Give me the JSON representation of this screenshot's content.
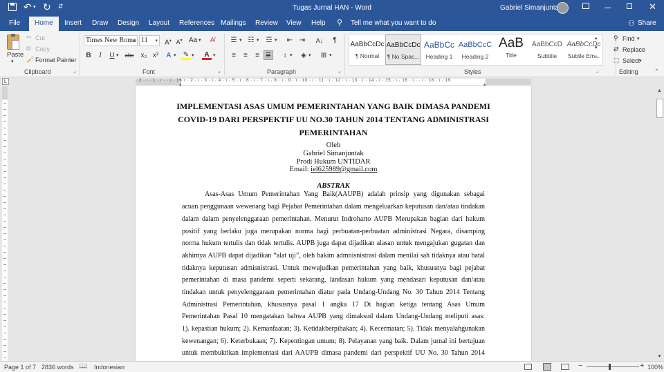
{
  "window": {
    "title": "Tugas Jurnal HAN  -  Word",
    "user": "Gabriel Simanjuntak"
  },
  "tabs": [
    "File",
    "Home",
    "Insert",
    "Draw",
    "Design",
    "Layout",
    "References",
    "Mailings",
    "Review",
    "View",
    "Help"
  ],
  "tell_me": "Tell me what you want to do",
  "share": "Share",
  "clipboard": {
    "paste": "Paste",
    "cut": "Cut",
    "copy": "Copy",
    "format_painter": "Format Painter",
    "label": "Clipboard"
  },
  "font": {
    "name": "Times New Roma",
    "size": "11",
    "label": "Font",
    "bold": "B",
    "italic": "I",
    "underline": "U",
    "strike": "abc",
    "sub": "x₂",
    "sup": "x²",
    "aa": "Aa"
  },
  "paragraph": {
    "label": "Paragraph"
  },
  "styles": {
    "label": "Styles",
    "items": [
      {
        "preview": "AaBbCcDc",
        "name": "¶ Normal"
      },
      {
        "preview": "AaBbCcDc",
        "name": "¶ No Spac..."
      },
      {
        "preview": "AaBbCc",
        "name": "Heading 1"
      },
      {
        "preview": "AaBbCcC",
        "name": "Heading 2"
      },
      {
        "preview": "AaB",
        "name": "Title"
      },
      {
        "preview": "AaBbCcD",
        "name": "Subtitle"
      },
      {
        "preview": "AaBbCcDc",
        "name": "Subtle Em..."
      }
    ]
  },
  "editing": {
    "find": "Find",
    "replace": "Replace",
    "select": "Select",
    "label": "Editing"
  },
  "ruler": "· 2 · ı · 1 · ı ·   · ı · 1 · ı · 2 · ı · 3 · ı · 4 · ı · 5 · ı · 6 · ı · 7 · ı · 8 · ı · 9 · ı · 10 · ı · 11 · ı · 12 · ı · 13 · ı · 14 · ı · 15 · ı · 16 · ı ·   · ı · 18 · ı · 19",
  "document": {
    "title_lines": [
      "IMPLEMENTASI ASAS UMUM PEMERINTAHAN YANG BAIK DIMASA PANDEMI",
      "COVID-19 DARI PERSPEKTIF UU NO.30 TAHUN 2014 TENTANG ADMINISTRASI",
      "PEMERINTAHAN"
    ],
    "oleh": "Oleh",
    "author": "Gabriel Simanjuntak",
    "affiliation": "Prodi Hukum UNTIDAR",
    "email_label": "Email: ",
    "email": "iel625989@gmail.com",
    "abstract_heading": "ABSTRAK",
    "abstract_lines": [
      "Asas-Asas Umum Pemerintahan Yang Baik(AAUPB) adalah prinsip yang digunakan sebagai",
      "acuan penggunaan wewenang bagi Pejabat Pemerintahan dalam mengeluarkan keputusan dan/atau tindakan",
      "dalam dalam penyelenggaraan pemerintahan. Menurut Indroharto AUPB Merupakan bagian dari hukum",
      "positif yang berlaku juga merupakan norma bagi perbuatan-perbuatan administrasi Negara, disamping",
      "norma hukum tertulis dan tidak tertulis. AUPB juga dapat dijadikan alasan untuk mengajukan gugatan dan",
      "akhirnya AUPB dapat dijadikan “alat uji”, oleh hakim admnisnistrasi dalam menilai sah tidaknya atau batal",
      "tidaknya keputusan admisnistrasi. Untuk mewujudkan pemerintahan yang baik, khususnya bagi pejabat",
      "pemerintahan di masa pandemi seperti sekarang, landasan hukum yang mendasari keputusan dan/atau",
      "tindakan untuk penyelenggaraan pemerintahan diatur pada Undang-Undang No. 30 Tahun 2014 Tentang",
      "Administrasi Pemerintahan, khususnya pasal 1 angka 17  Di bagian ketiga tentang Asas Umum",
      "Pemerintahan Pasal 10 mengatakan bahwa AUPB yang dimaksud dalam Undang-Undang meliputi asas:",
      "1). kepastian hukum; 2). Kemanfaatan; 3). Ketidakberpihakan; 4). Kecermatan; 5). Tidak menyalahgunakan",
      "kewenangan; 6). Keterbukaan; 7). Kepentingan umum; 8). Pelayanan yang baik. Dalam jurnal ini bertujuan",
      "untuk membuktikan implementasi dari AAUPB dimasa pandemi dari perspektif UU No. 30 Tahun 2014"
    ]
  },
  "status": {
    "page": "Page 1 of 7",
    "words": "2836 words",
    "language": "Indonesian",
    "zoom": "100%"
  }
}
